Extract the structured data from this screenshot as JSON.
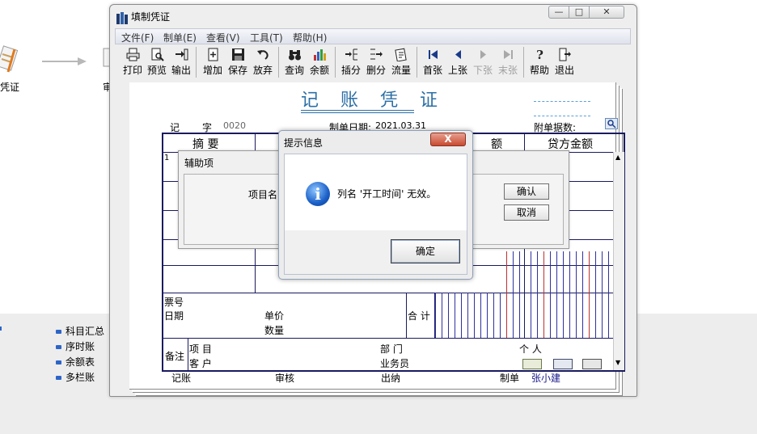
{
  "background": {
    "voucher_label": "凭证",
    "partial_label": "审",
    "list_items": [
      "科目汇总",
      "序时账",
      "余额表",
      "多栏账"
    ]
  },
  "window": {
    "title": "填制凭证",
    "menu": [
      "文件(F)",
      "制单(E)",
      "查看(V)",
      "工具(T)",
      "帮助(H)"
    ],
    "toolbar": [
      {
        "label": "打印",
        "icon": "printer-icon",
        "enabled": true
      },
      {
        "label": "预览",
        "icon": "preview-icon",
        "enabled": true
      },
      {
        "label": "输出",
        "icon": "export-icon",
        "enabled": true
      },
      {
        "label": "增加",
        "icon": "add-icon",
        "enabled": true
      },
      {
        "label": "保存",
        "icon": "save-icon",
        "enabled": true
      },
      {
        "label": "放弃",
        "icon": "undo-icon",
        "enabled": true
      },
      {
        "label": "查询",
        "icon": "binoculars-icon",
        "enabled": true
      },
      {
        "label": "余额",
        "icon": "balance-chart-icon",
        "enabled": true
      },
      {
        "label": "插分",
        "icon": "insert-row-icon",
        "enabled": true
      },
      {
        "label": "删分",
        "icon": "delete-row-icon",
        "enabled": true
      },
      {
        "label": "流量",
        "icon": "flow-icon",
        "enabled": true
      },
      {
        "label": "首张",
        "icon": "first-icon",
        "enabled": true
      },
      {
        "label": "上张",
        "icon": "prev-icon",
        "enabled": true
      },
      {
        "label": "下张",
        "icon": "next-icon",
        "enabled": false
      },
      {
        "label": "末张",
        "icon": "last-icon",
        "enabled": false
      },
      {
        "label": "帮助",
        "icon": "help-icon",
        "enabled": true
      },
      {
        "label": "退出",
        "icon": "exit-icon",
        "enabled": true
      }
    ]
  },
  "voucher": {
    "title": "记 账 凭 证",
    "type_label": "记",
    "number_label": "字",
    "number": "0020",
    "date_label": "制单日期:",
    "date": "2021.03.31",
    "attachments_label": "附单据数:",
    "col_summary": "摘 要",
    "col_debit_partial": "额",
    "col_credit": "贷方金额",
    "row1_num": "1",
    "bill_no_label": "票号",
    "date_field_label": "日期",
    "unit_price_label": "单价",
    "quantity_label": "数量",
    "total_label": "合 计",
    "remark_label": "备注",
    "project_label": "项 目",
    "customer_label": "客 户",
    "department_label": "部 门",
    "salesman_label": "业务员",
    "person_label": "个 人",
    "footer": {
      "bookkeep_label": "记账",
      "review_label": "审核",
      "cashier_label": "出纳",
      "maker_label": "制单",
      "maker_name": "张小建"
    }
  },
  "aux_dialog": {
    "title": "辅助项",
    "project_name_label": "项目名",
    "confirm": "确认",
    "cancel": "取消"
  },
  "message_box": {
    "title": "提示信息",
    "message": "列名 '开工时间' 无效。",
    "ok": "确定",
    "close": "X"
  },
  "colors": {
    "title_blue": "#2c6fa6",
    "grid_navy": "#1a1a60",
    "amount_red": "#c03030"
  }
}
